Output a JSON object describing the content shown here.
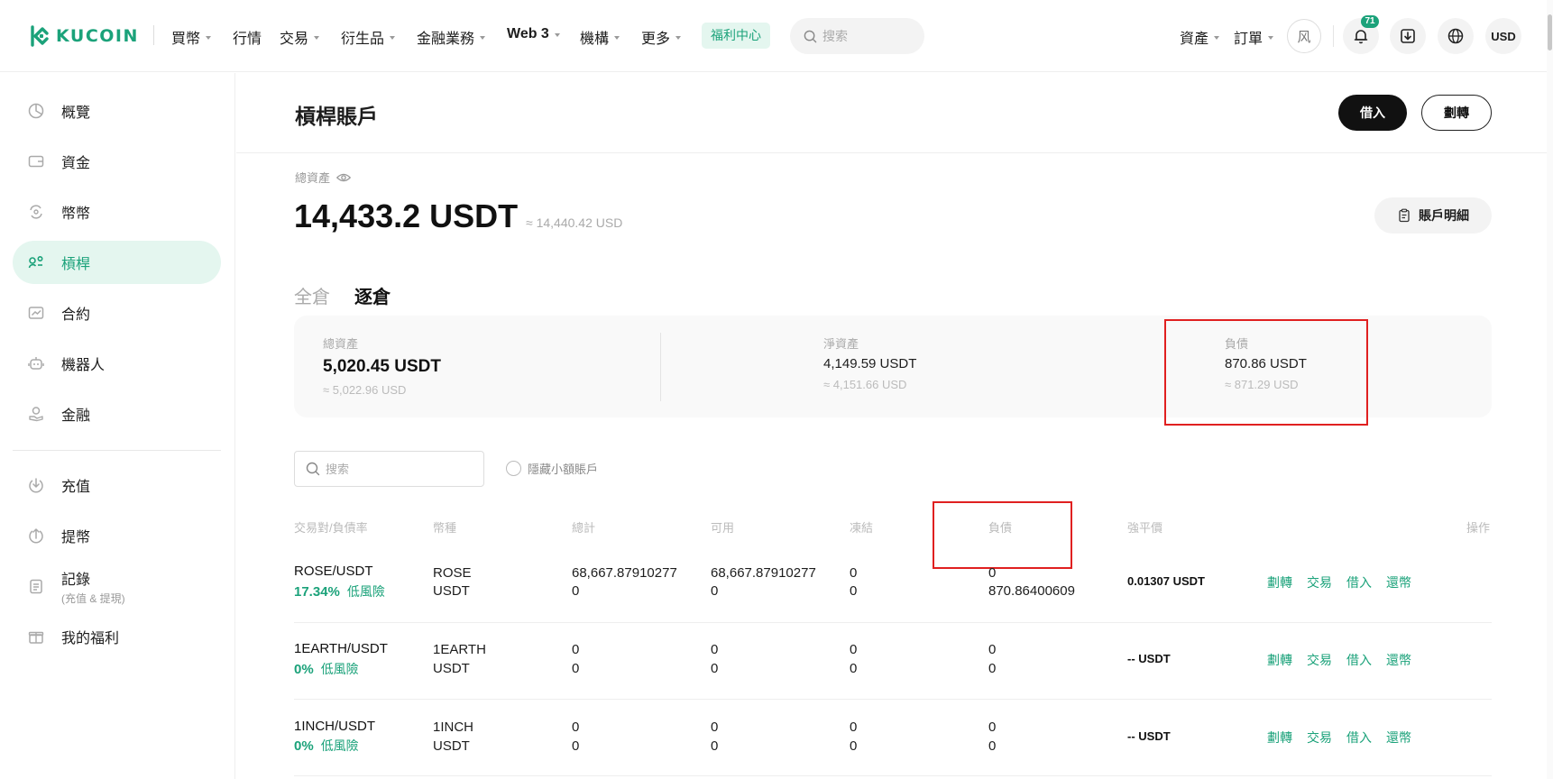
{
  "brand": {
    "name": "KUCOIN",
    "color": "#1ba27a"
  },
  "nav": [
    {
      "label": "買幣",
      "caret": true
    },
    {
      "label": "行情",
      "caret": false
    },
    {
      "label": "交易",
      "caret": true
    },
    {
      "label": "衍生品",
      "caret": true
    },
    {
      "label": "金融業務",
      "caret": true
    },
    {
      "label": "Web 3",
      "caret": true
    },
    {
      "label": "機構",
      "caret": true
    },
    {
      "label": "更多",
      "caret": true
    }
  ],
  "welfare": "福利中心",
  "top_search": {
    "placeholder": "搜索"
  },
  "top_right": {
    "assets": "資產",
    "orders": "訂單",
    "avatar": "风",
    "notifications_badge": "71",
    "currency": "USD"
  },
  "sidebar": {
    "items": [
      {
        "label": "概覽",
        "icon": "pie-chart-icon"
      },
      {
        "label": "資金",
        "icon": "wallet-icon"
      },
      {
        "label": "幣幣",
        "icon": "exchange-icon"
      },
      {
        "label": "槓桿",
        "icon": "margin-icon"
      },
      {
        "label": "合約",
        "icon": "futures-icon"
      },
      {
        "label": "機器人",
        "icon": "robot-icon"
      },
      {
        "label": "金融",
        "icon": "earn-icon"
      }
    ],
    "items2": [
      {
        "label": "充值",
        "icon": "deposit-icon"
      },
      {
        "label": "提幣",
        "icon": "withdraw-icon"
      },
      {
        "label": "記錄",
        "sub": "(充值 & 提現)",
        "icon": "record-icon"
      },
      {
        "label": "我的福利",
        "icon": "gift-icon"
      }
    ]
  },
  "page": {
    "title": "槓桿賬戶",
    "borrow_btn": "借入",
    "transfer_btn": "劃轉",
    "total_label": "總資產",
    "total_amount": "14,433.2 USDT",
    "total_approx": "≈ 14,440.42 USD",
    "detail_btn": "賬戶明細",
    "tabs": {
      "cross": "全倉",
      "isolated": "逐倉"
    }
  },
  "summary": {
    "total": {
      "label": "總資產",
      "value": "5,020.45 USDT",
      "approx": "≈ 5,022.96 USD"
    },
    "net": {
      "label": "淨資產",
      "value": "4,149.59 USDT",
      "approx": "≈ 4,151.66 USD"
    },
    "debt": {
      "label": "負債",
      "value": "870.86 USDT",
      "approx": "≈ 871.29 USD"
    }
  },
  "filter": {
    "search_placeholder": "搜索",
    "hide_small": "隱藏小額賬戶"
  },
  "table": {
    "headers": {
      "pair": "交易對/負債率",
      "coin": "幣種",
      "total": "總計",
      "available": "可用",
      "frozen": "凍結",
      "debt": "負債",
      "liq": "強平價",
      "ops": "操作"
    },
    "actions": [
      "劃轉",
      "交易",
      "借入",
      "還幣"
    ],
    "rows": [
      {
        "pair": "ROSE/USDT",
        "rate": "17.34%",
        "risk": "低風險",
        "coins": [
          "ROSE",
          "USDT"
        ],
        "total": [
          "68,667.87910277",
          "0"
        ],
        "available": [
          "68,667.87910277",
          "0"
        ],
        "frozen": [
          "0",
          "0"
        ],
        "debt": [
          "0",
          "870.86400609"
        ],
        "liq": "0.01307 USDT"
      },
      {
        "pair": "1EARTH/USDT",
        "rate": "0%",
        "risk": "低風險",
        "coins": [
          "1EARTH",
          "USDT"
        ],
        "total": [
          "0",
          "0"
        ],
        "available": [
          "0",
          "0"
        ],
        "frozen": [
          "0",
          "0"
        ],
        "debt": [
          "0",
          "0"
        ],
        "liq": "-- USDT"
      },
      {
        "pair": "1INCH/USDT",
        "rate": "0%",
        "risk": "低風險",
        "coins": [
          "1INCH",
          "USDT"
        ],
        "total": [
          "0",
          "0"
        ],
        "available": [
          "0",
          "0"
        ],
        "frozen": [
          "0",
          "0"
        ],
        "debt": [
          "0",
          "0"
        ],
        "liq": "-- USDT"
      }
    ]
  }
}
